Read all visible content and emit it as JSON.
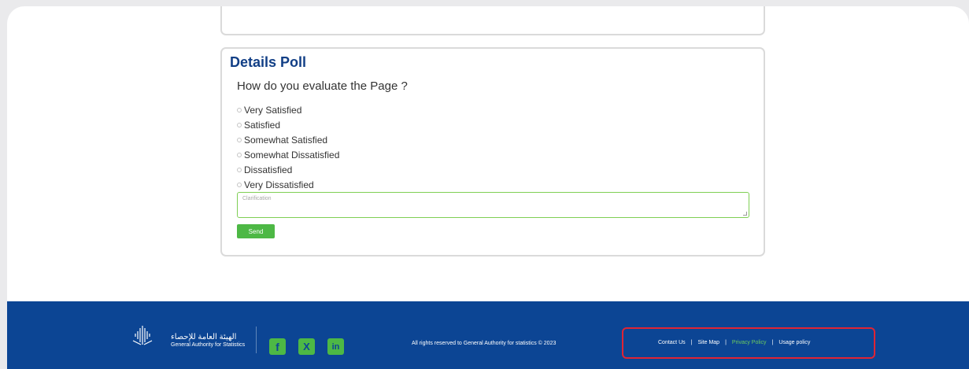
{
  "poll": {
    "title": "Details Poll",
    "question": "How do you evaluate the Page ?",
    "options": [
      "Very Satisfied",
      "Satisfied",
      "Somewhat Satisfied",
      "Somewhat Dissatisfied",
      "Dissatisfied",
      "Very Dissatisfied"
    ],
    "clarification_placeholder": "Clarification",
    "send_label": "Send"
  },
  "footer": {
    "logo_arabic": "الهيئة العامة للإحصاء",
    "logo_english": "General Authority for Statistics",
    "social": {
      "facebook": "f",
      "x": "X",
      "linkedin": "in"
    },
    "copyright": "All rights reserved to General Authority for statistics © 2023",
    "links": {
      "contact_us": "Contact Us",
      "site_map": "Site Map",
      "privacy_policy": "Privacy Policy",
      "usage_policy": "Usage policy",
      "separator": "|"
    }
  },
  "colors": {
    "title_blue": "#123f86",
    "footer_blue": "#0c4594",
    "accent_green": "#4db845",
    "highlight_red": "#e02434"
  }
}
